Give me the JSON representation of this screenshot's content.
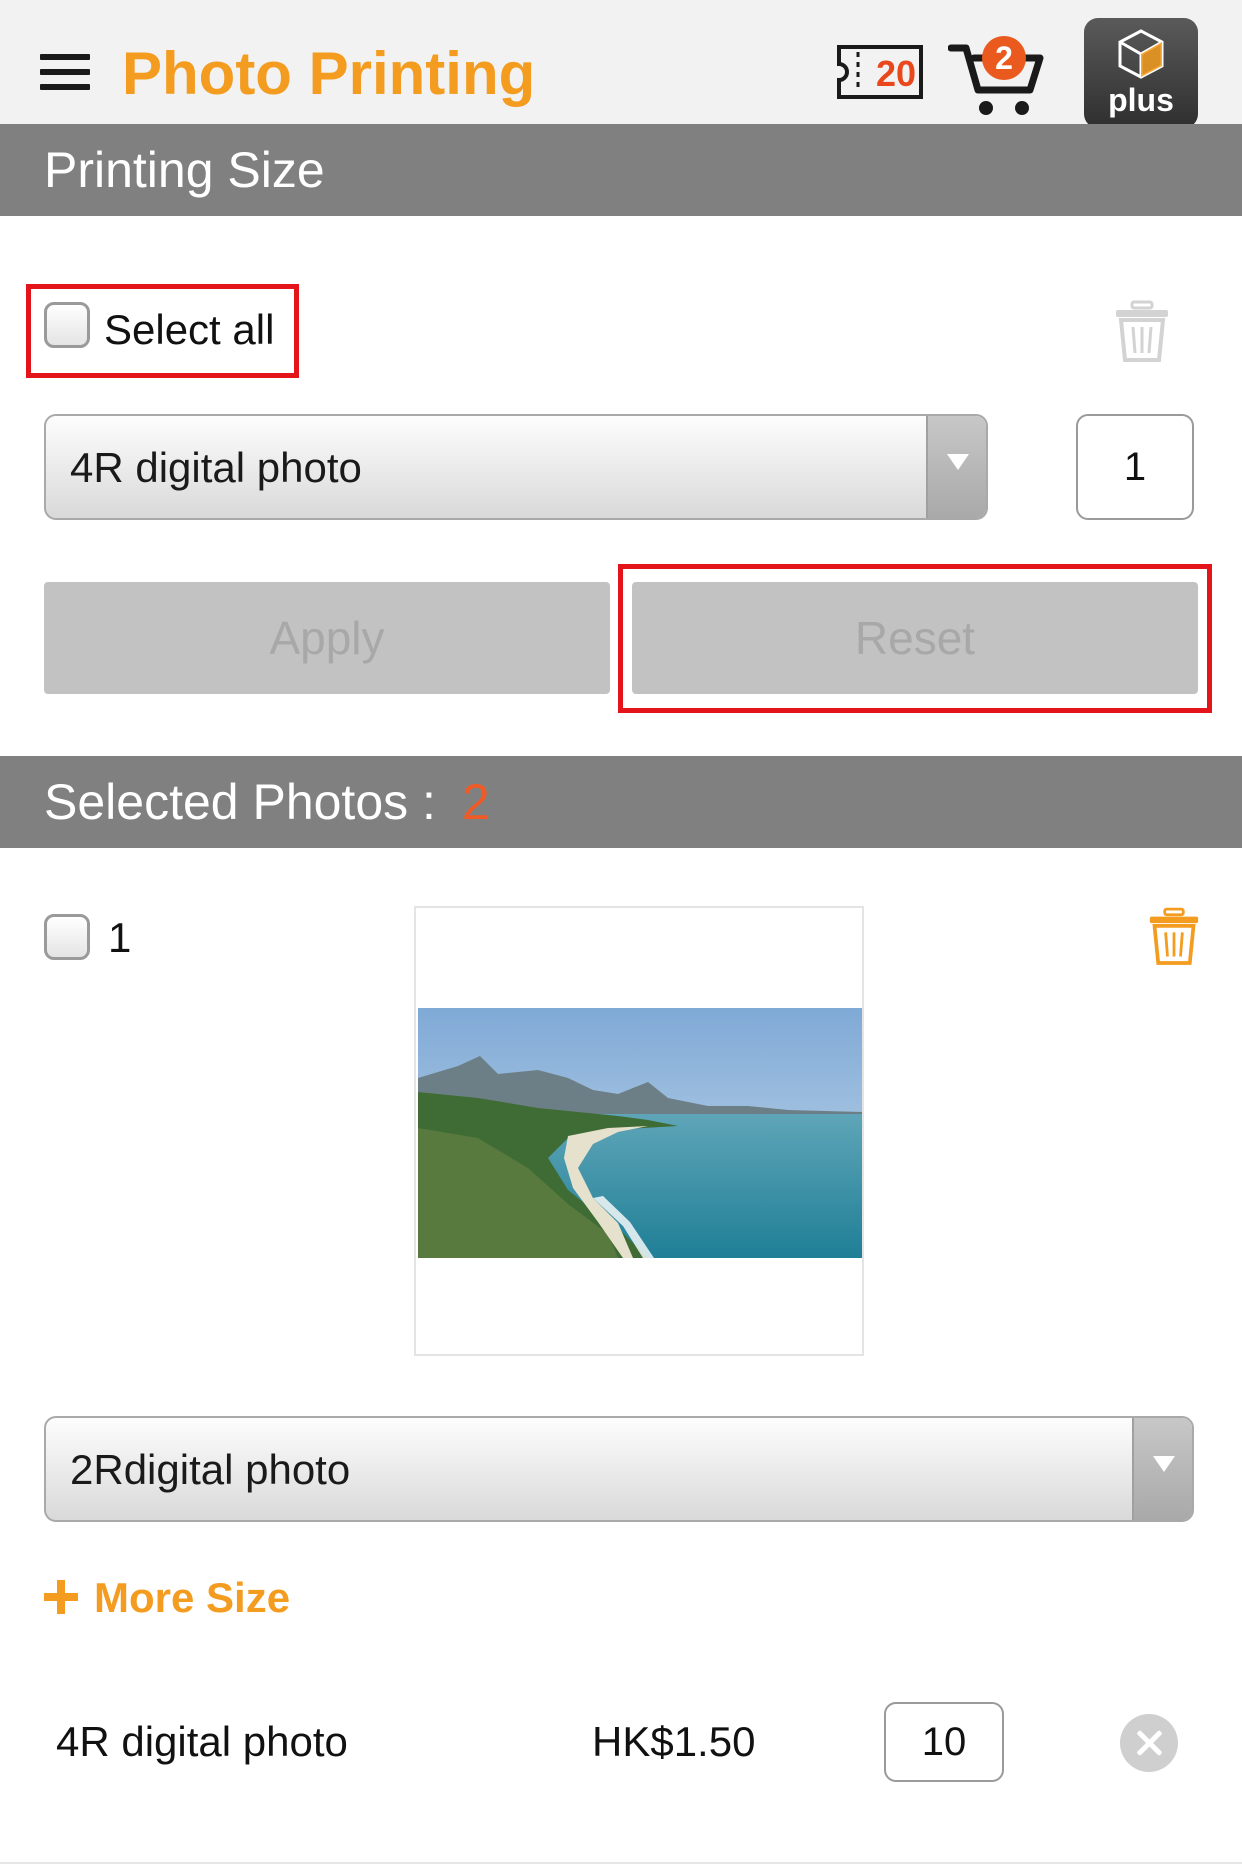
{
  "header": {
    "title": "Photo Printing",
    "coupon_count": "20",
    "cart_count": "2",
    "plus_label": "plus",
    "accent_color": "#f39c1f"
  },
  "printing_size": {
    "section_title": "Printing Size",
    "select_all_label": "Select all",
    "size_select_value": "4R digital photo",
    "quantity_value": "1",
    "apply_label": "Apply",
    "reset_label": "Reset"
  },
  "selected_photos": {
    "section_title": "Selected Photos :",
    "count": "2",
    "items": [
      {
        "number": "1",
        "size_select_value": "2Rdigital photo",
        "more_size_label": "More Size",
        "sizes": [
          {
            "name": "4R digital photo",
            "price": "HK$1.50",
            "quantity": "10"
          }
        ]
      }
    ]
  },
  "icons": [
    "menu-icon",
    "coupon-icon",
    "cart-icon",
    "plus-logo-icon",
    "trash-icon",
    "chevron-down-icon",
    "plus-icon",
    "close-icon"
  ]
}
